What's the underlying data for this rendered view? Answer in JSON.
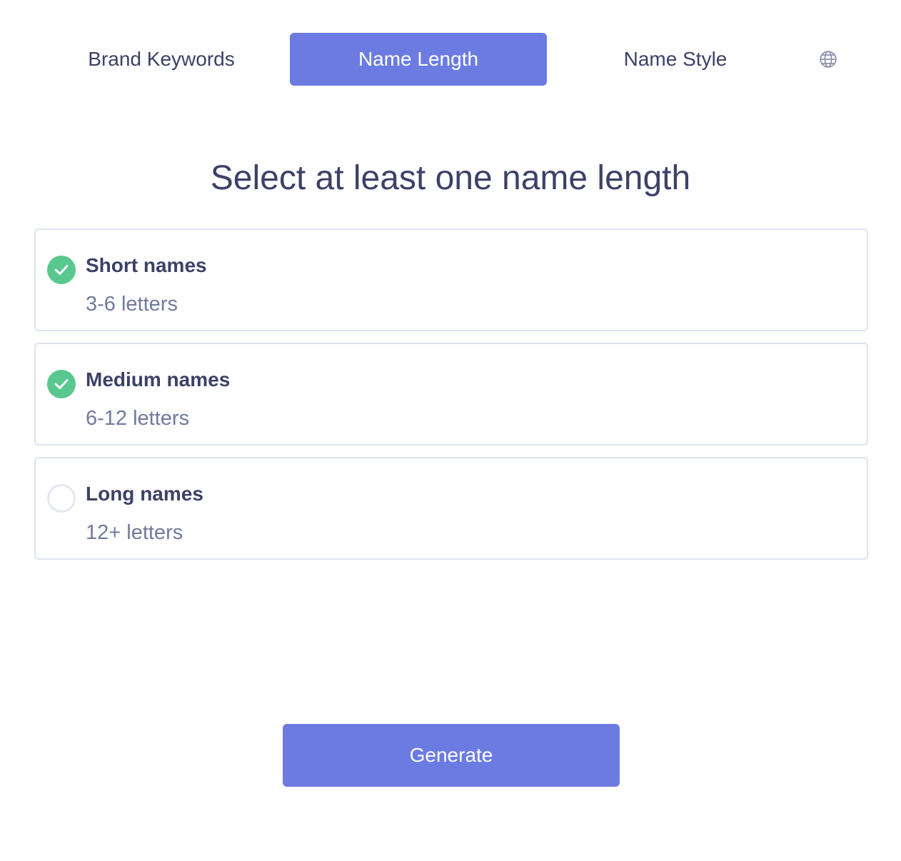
{
  "tabs": [
    {
      "label": "Brand Keywords",
      "active": false
    },
    {
      "label": "Name Length",
      "active": true
    },
    {
      "label": "Name Style",
      "active": false
    }
  ],
  "language_icon": "globe-icon",
  "heading": "Select at least one name length",
  "options": [
    {
      "title": "Short names",
      "subtitle": "3-6 letters",
      "checked": true
    },
    {
      "title": "Medium names",
      "subtitle": "6-12 letters",
      "checked": true
    },
    {
      "title": "Long names",
      "subtitle": "12+ letters",
      "checked": false
    }
  ],
  "generate_label": "Generate",
  "colors": {
    "accent": "#6b7be2",
    "check": "#58c88e",
    "text": "#3c4167",
    "muted": "#717a9c",
    "border": "#dde3ee"
  }
}
